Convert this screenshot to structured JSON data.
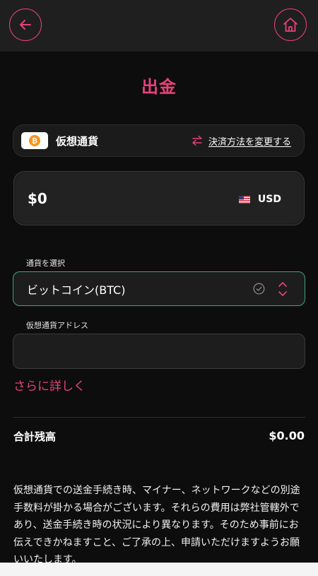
{
  "header": {
    "back_icon": "arrow-left-icon",
    "home_icon": "home-icon",
    "accent_color": "#e8417b"
  },
  "page": {
    "title": "出金"
  },
  "payment_method": {
    "icon": "bitcoin-icon",
    "label": "仮想通貨",
    "change_icon": "swap-arrows-icon",
    "change_link": "決済方法を変更する"
  },
  "amount": {
    "value": "$0",
    "currency_flag": "us-flag-icon",
    "currency": "USD"
  },
  "currency_select": {
    "label": "通貨を選択",
    "selected": "ビットコイン(BTC)",
    "valid_color": "#3da57b"
  },
  "address": {
    "label": "仮想通貨アドレス",
    "value": ""
  },
  "more_link": "さらに詳しく",
  "total": {
    "label": "合計残高",
    "value": "$0.00"
  },
  "notice": "仮想通貨での送金手続き時、マイナー、ネットワークなどの別途手数料が掛かる場合がございます。それらの費用は弊社管轄外であり、送金手続き時の状況により異なります。そのため事前にお伝えできかねますこと、ご了承の上、申請いただけますようお願いいたします。"
}
